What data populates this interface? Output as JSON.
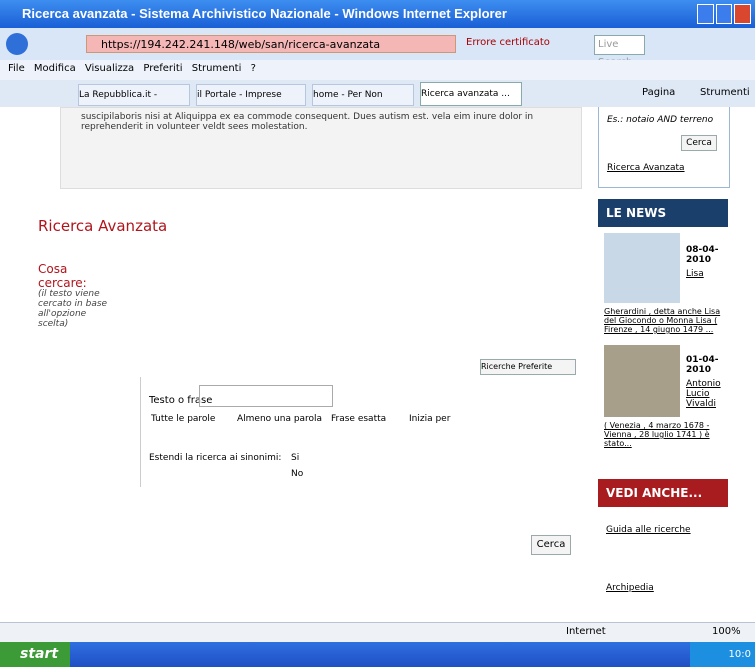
{
  "window": {
    "title": "Ricerca avanzata - Sistema Archivistico Nazionale - Windows Internet Explorer"
  },
  "address": {
    "url": "https://194.242.241.148/web/san/ricerca-avanzata",
    "cert_error": "Errore certificato",
    "search_placeholder": "Live Search"
  },
  "menu": [
    "File",
    "Modifica",
    "Visualizza",
    "Preferiti",
    "Strumenti",
    "?"
  ],
  "tabs": [
    "La Repubblica.it - Hom...",
    "il Portale - Imprese",
    "home - Per Non Dimen...",
    "Ricerca avanzata ..."
  ],
  "toolbar_right": {
    "page": "Pagina",
    "tools": "Strumenti"
  },
  "main": {
    "lorem": "suscipilaboris nisi at Aliquippa ex ea commode consequent. Dues autism est. vela eim inure dolor in reprehenderit in volunteer veldt sees molestation.",
    "title": "Ricerca Avanzata",
    "cosa": "Cosa cercare:",
    "cosa_note": "(il testo viene cercato in base all'opzione scelta)",
    "preferite": "Ricerche Preferite",
    "testo_label": "Testo o frase",
    "options": [
      "Tutte le parole",
      "Almeno una parola",
      "Frase esatta",
      "Inizia per"
    ],
    "sinonimi_label": "Estendi la ricerca ai sinonimi:",
    "si": "Si",
    "no": "No",
    "cerca": "Cerca"
  },
  "sidebar": {
    "hint": "Es.: notaio AND terreno",
    "cerca": "Cerca",
    "link_avanzata": "Ricerca Avanzata",
    "news_title": "LE NEWS",
    "news1": {
      "date": "08-04-2010",
      "who": "Lisa",
      "text": "Gherardini , detta anche Lisa del Giocondo o Monna Lisa ( Firenze , 14 giugno 1479 ..."
    },
    "news2": {
      "date": "01-04-2010",
      "who": "Antonio Lucio Vivaldi",
      "text": "( Venezia , 4 marzo 1678 - Vienna , 28 luglio 1741 ) è stato..."
    },
    "vedi_title": "VEDI ANCHE...",
    "vedi1": "Guida alle ricerche",
    "vedi2": "Archipedia"
  },
  "status": {
    "zone": "Internet",
    "zoom": "100%"
  },
  "taskbar": {
    "start": "start",
    "clock": "10:0"
  }
}
